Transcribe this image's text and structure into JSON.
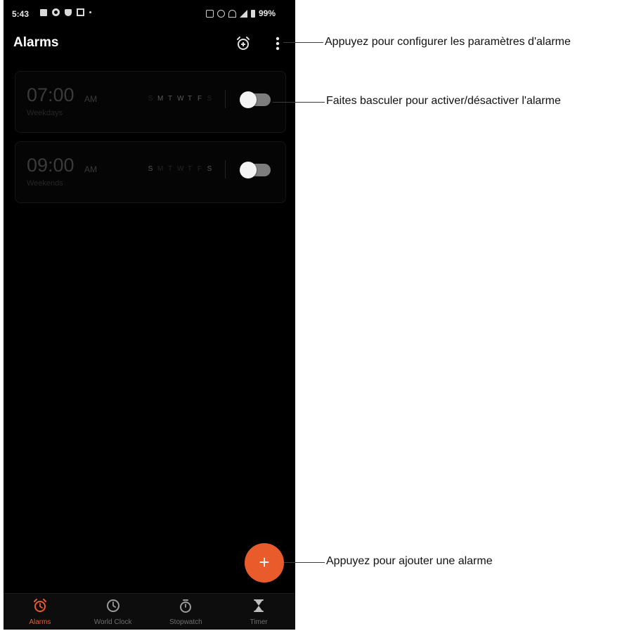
{
  "status_bar": {
    "time": "5:43",
    "battery": "99%",
    "left_icons": [
      "message-icon",
      "settings-icon",
      "shield-icon",
      "photo-icon",
      "dot-icon"
    ],
    "right_icons": [
      "nfc-icon",
      "vibrate-icon",
      "wifi-icon",
      "signal-icon",
      "battery-icon"
    ]
  },
  "app_bar": {
    "title": "Alarms",
    "actions": [
      "alarm-settings-icon",
      "more-vert-icon"
    ]
  },
  "alarms": [
    {
      "time": "07:00",
      "ampm": "AM",
      "label": "Weekdays",
      "days": [
        {
          "letter": "S",
          "active": false
        },
        {
          "letter": "M",
          "active": true
        },
        {
          "letter": "T",
          "active": true
        },
        {
          "letter": "W",
          "active": true
        },
        {
          "letter": "T",
          "active": true
        },
        {
          "letter": "F",
          "active": true
        },
        {
          "letter": "S",
          "active": false
        }
      ],
      "enabled": false
    },
    {
      "time": "09:00",
      "ampm": "AM",
      "label": "Weekends",
      "days": [
        {
          "letter": "S",
          "active": true
        },
        {
          "letter": "M",
          "active": false
        },
        {
          "letter": "T",
          "active": false
        },
        {
          "letter": "W",
          "active": false
        },
        {
          "letter": "T",
          "active": false
        },
        {
          "letter": "F",
          "active": false
        },
        {
          "letter": "S",
          "active": true
        }
      ],
      "enabled": false
    }
  ],
  "fab": {
    "symbol": "+"
  },
  "bottom_nav": [
    {
      "label": "Alarms",
      "icon": "alarm-icon",
      "active": true
    },
    {
      "label": "World Clock",
      "icon": "clock-icon",
      "active": false
    },
    {
      "label": "Stopwatch",
      "icon": "stopwatch-icon",
      "active": false
    },
    {
      "label": "Timer",
      "icon": "hourglass-icon",
      "active": false
    }
  ],
  "callouts": {
    "settings": "Appuyez pour configurer les paramètres d'alarme",
    "toggle": "Faites basculer pour activer/désactiver l'alarme",
    "add": "Appuyez pour ajouter une alarme"
  },
  "colors": {
    "accent": "#ea5b2c",
    "background": "#000000",
    "toggle_off_track": "#7d7d7d"
  }
}
